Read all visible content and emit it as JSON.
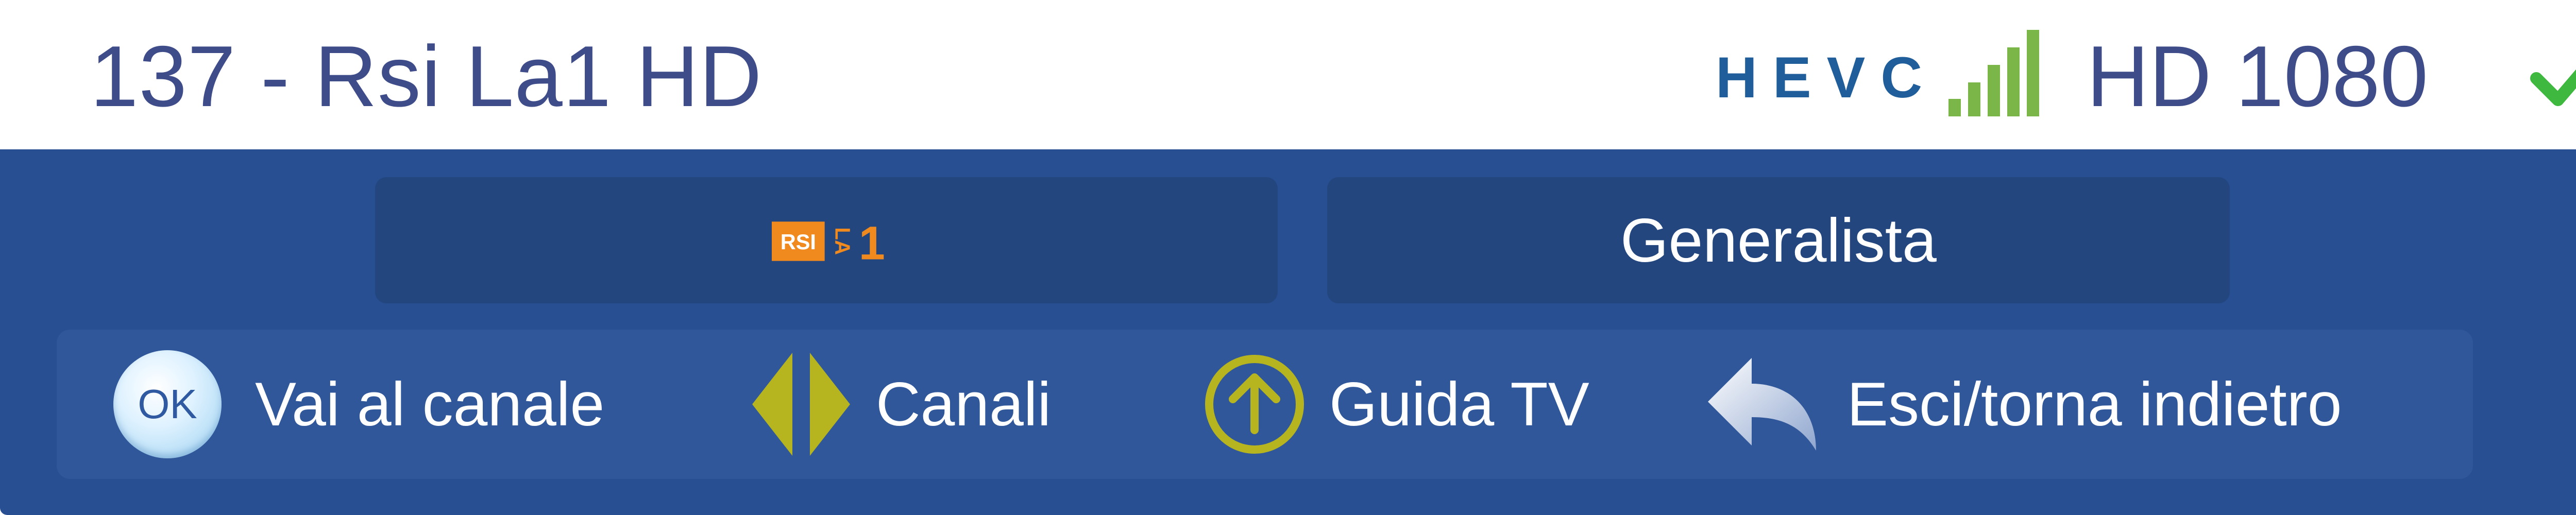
{
  "header": {
    "channel_title": "137 - Rsi La1 HD",
    "codec": "HEVC",
    "signal": {
      "level": 5,
      "max": 5,
      "color": "#7ab648"
    },
    "resolution": "HD 1080",
    "status_icon": "check-icon",
    "status_color": "#3fb83f"
  },
  "info": {
    "logo_text_rsi": "RSI",
    "logo_text_la": "LA",
    "logo_text_one": "1",
    "logo_color": "#f08a1e",
    "genre": "Generalista"
  },
  "hints": [
    {
      "icon": "ok-button-icon",
      "icon_text": "OK",
      "label": "Vai al canale"
    },
    {
      "icon": "left-right-arrows-icon",
      "label": "Canali"
    },
    {
      "icon": "up-arrow-circle-icon",
      "label": "Guida TV"
    },
    {
      "icon": "back-arrow-icon",
      "label": "Esci/torna indietro"
    }
  ],
  "colors": {
    "title_text": "#3f4c8a",
    "panel_background": "#284f92",
    "box_background": "#23467f",
    "hint_bar_background": "#30579a",
    "hint_icon_yellow": "#b6b51f",
    "hevc_blue": "#1f5e9a"
  }
}
